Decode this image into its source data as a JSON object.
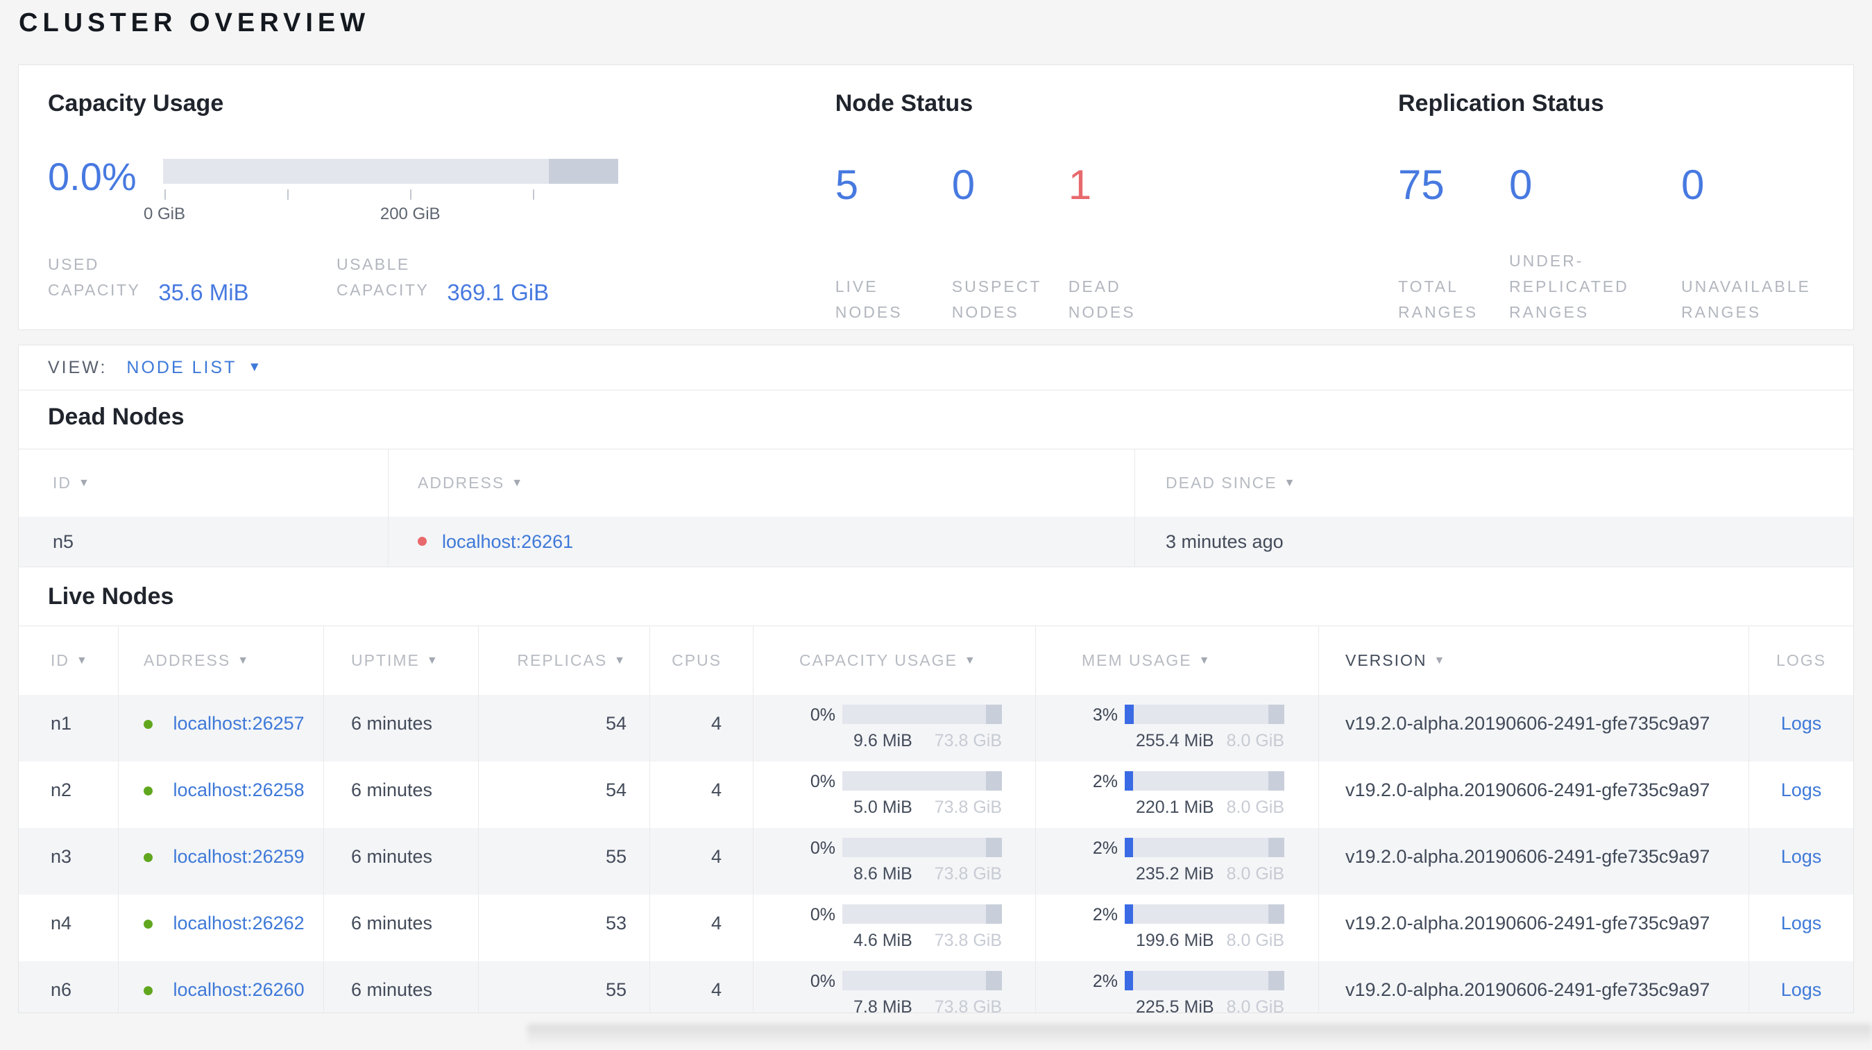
{
  "page": {
    "title": "CLUSTER OVERVIEW"
  },
  "colors": {
    "accent_blue": "#4779e0",
    "link_blue": "#3e79d8",
    "danger_red": "#e8696d",
    "healthy_green": "#60a71e",
    "label_gray": "#b2b6be",
    "slate": "#434b5a",
    "bar_light": "#e3e6ed",
    "bar_dark": "#c9cfda",
    "mem_blue": "#3b6be4",
    "row_alt": "#f4f5f7",
    "value_light": "#c7cbd3"
  },
  "summary": {
    "capacity": {
      "title": "Capacity Usage",
      "percent": "0.0%",
      "axis": [
        "0 GiB",
        "200 GiB"
      ],
      "used": {
        "label_lines": [
          "USED",
          "CAPACITY"
        ],
        "value": "35.6 MiB"
      },
      "usable": {
        "label_lines": [
          "USABLE",
          "CAPACITY"
        ],
        "value": "369.1 GiB"
      }
    },
    "node_status": {
      "title": "Node Status",
      "stats": [
        {
          "value": "5",
          "label_lines": [
            "LIVE",
            "NODES"
          ]
        },
        {
          "value": "0",
          "label_lines": [
            "SUSPECT",
            "NODES"
          ]
        },
        {
          "value": "1",
          "label_lines": [
            "DEAD",
            "NODES"
          ]
        }
      ]
    },
    "replication": {
      "title": "Replication Status",
      "stats": [
        {
          "value": "75",
          "label_lines": [
            "TOTAL",
            "RANGES"
          ]
        },
        {
          "value": "0",
          "label_lines": [
            "UNDER-",
            "REPLICATED",
            "RANGES"
          ]
        },
        {
          "value": "0",
          "label_lines": [
            "UNAVAILABLE",
            "RANGES"
          ]
        }
      ]
    }
  },
  "view_bar": {
    "label": "VIEW:",
    "selected": "NODE LIST"
  },
  "dead_nodes": {
    "title": "Dead Nodes",
    "headers": [
      "ID",
      "ADDRESS",
      "DEAD SINCE"
    ],
    "rows": [
      {
        "id": "n5",
        "address": "localhost:26261",
        "dead_since": "3 minutes ago"
      }
    ]
  },
  "live_nodes": {
    "title": "Live Nodes",
    "headers": [
      "ID",
      "ADDRESS",
      "UPTIME",
      "REPLICAS",
      "CPUS",
      "CAPACITY USAGE",
      "MEM USAGE",
      "VERSION",
      "LOGS"
    ],
    "rows": [
      {
        "id": "n1",
        "address": "localhost:26257",
        "uptime": "6 minutes",
        "replicas": "54",
        "cpus": "4",
        "capacity": {
          "percent": "0%",
          "used": "9.6 MiB",
          "total": "73.8 GiB",
          "fill_pct": 0
        },
        "memory": {
          "percent": "3%",
          "used": "255.4 MiB",
          "total": "8.0 GiB",
          "fill_pct": 5.5
        },
        "version": "v19.2.0-alpha.20190606-2491-gfe735c9a97",
        "logs": "Logs"
      },
      {
        "id": "n2",
        "address": "localhost:26258",
        "uptime": "6 minutes",
        "replicas": "54",
        "cpus": "4",
        "capacity": {
          "percent": "0%",
          "used": "5.0 MiB",
          "total": "73.8 GiB",
          "fill_pct": 0
        },
        "memory": {
          "percent": "2%",
          "used": "220.1 MiB",
          "total": "8.0 GiB",
          "fill_pct": 5
        },
        "version": "v19.2.0-alpha.20190606-2491-gfe735c9a97",
        "logs": "Logs"
      },
      {
        "id": "n3",
        "address": "localhost:26259",
        "uptime": "6 minutes",
        "replicas": "55",
        "cpus": "4",
        "capacity": {
          "percent": "0%",
          "used": "8.6 MiB",
          "total": "73.8 GiB",
          "fill_pct": 0
        },
        "memory": {
          "percent": "2%",
          "used": "235.2 MiB",
          "total": "8.0 GiB",
          "fill_pct": 5
        },
        "version": "v19.2.0-alpha.20190606-2491-gfe735c9a97",
        "logs": "Logs"
      },
      {
        "id": "n4",
        "address": "localhost:26262",
        "uptime": "6 minutes",
        "replicas": "53",
        "cpus": "4",
        "capacity": {
          "percent": "0%",
          "used": "4.6 MiB",
          "total": "73.8 GiB",
          "fill_pct": 0
        },
        "memory": {
          "percent": "2%",
          "used": "199.6 MiB",
          "total": "8.0 GiB",
          "fill_pct": 5
        },
        "version": "v19.2.0-alpha.20190606-2491-gfe735c9a97",
        "logs": "Logs"
      },
      {
        "id": "n6",
        "address": "localhost:26260",
        "uptime": "6 minutes",
        "replicas": "55",
        "cpus": "4",
        "capacity": {
          "percent": "0%",
          "used": "7.8 MiB",
          "total": "73.8 GiB",
          "fill_pct": 0
        },
        "memory": {
          "percent": "2%",
          "used": "225.5 MiB",
          "total": "8.0 GiB",
          "fill_pct": 5
        },
        "version": "v19.2.0-alpha.20190606-2491-gfe735c9a97",
        "logs": "Logs"
      }
    ]
  }
}
